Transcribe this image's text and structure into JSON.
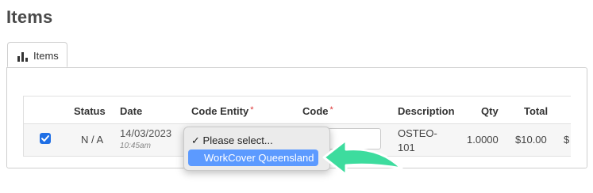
{
  "page": {
    "title": "Items"
  },
  "tabs": [
    {
      "label": "Items",
      "icon": "bar-chart-icon",
      "active": true
    }
  ],
  "table": {
    "columns": {
      "status": "Status",
      "date": "Date",
      "code_entity": "Code Entity",
      "code": "Code",
      "description": "Description",
      "qty": "Qty",
      "total": "Total"
    },
    "required_marker": "*",
    "rows": [
      {
        "selected": true,
        "status": "N / A",
        "date": "14/03/2023",
        "time": "10:45am",
        "description_line1": "OSTEO-",
        "description_line2": "101",
        "qty": "1.0000",
        "total": "$10.00",
        "overflow": "$"
      }
    ]
  },
  "dropdown": {
    "check": "✓",
    "options": [
      {
        "label": "Please select...",
        "checked": true
      },
      {
        "label": "WorkCover Queensland",
        "highlighted": true
      }
    ]
  },
  "colors": {
    "accent": "#1f6fe5",
    "highlight": "#5c9aff",
    "arrow": "#3ddc9e",
    "required": "#dd3333"
  }
}
